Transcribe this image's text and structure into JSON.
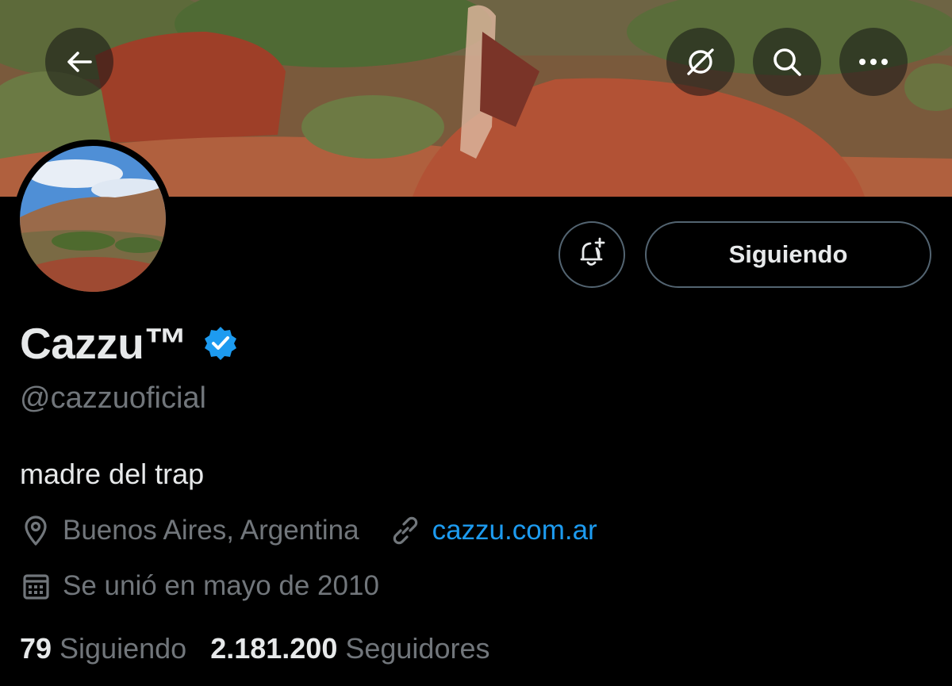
{
  "profile": {
    "display_name": "Cazzu™",
    "handle": "@cazzuoficial",
    "bio": "madre del trap",
    "location": "Buenos Aires, Argentina",
    "website": "cazzu.com.ar",
    "joined": "Se unió en mayo de 2010",
    "verified": true
  },
  "actions": {
    "follow_label": "Siguiendo"
  },
  "stats": {
    "following_count": "79",
    "following_label": "Siguiendo",
    "followers_count": "2.181.200",
    "followers_label": "Seguidores"
  },
  "header": {
    "icons": [
      "back-arrow-icon",
      "grok-icon",
      "search-icon",
      "more-icon"
    ]
  },
  "colors": {
    "background": "#000000",
    "text_primary": "#e7e9ea",
    "text_secondary": "#71767b",
    "accent": "#1d9bf0",
    "border": "#536471"
  }
}
